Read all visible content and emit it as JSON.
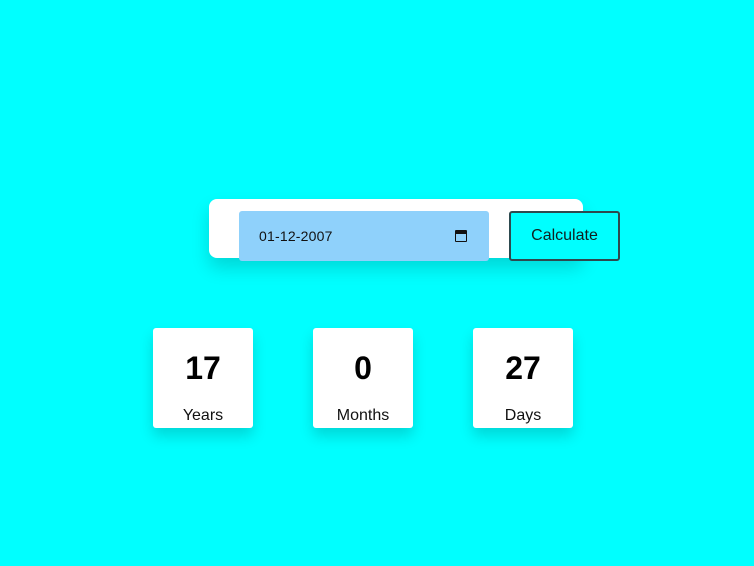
{
  "colors": {
    "background": "#00ffff",
    "card": "#ffffff",
    "date_field": "#8fd1fb",
    "button_border": "#2d4a4f"
  },
  "date_input": {
    "value": "01-12-2007",
    "icon": "calendar-icon"
  },
  "calculate_button": {
    "label": "Calculate"
  },
  "results": {
    "years": {
      "value": "17",
      "label": "Years"
    },
    "months": {
      "value": "0",
      "label": "Months"
    },
    "days": {
      "value": "27",
      "label": "Days"
    }
  }
}
